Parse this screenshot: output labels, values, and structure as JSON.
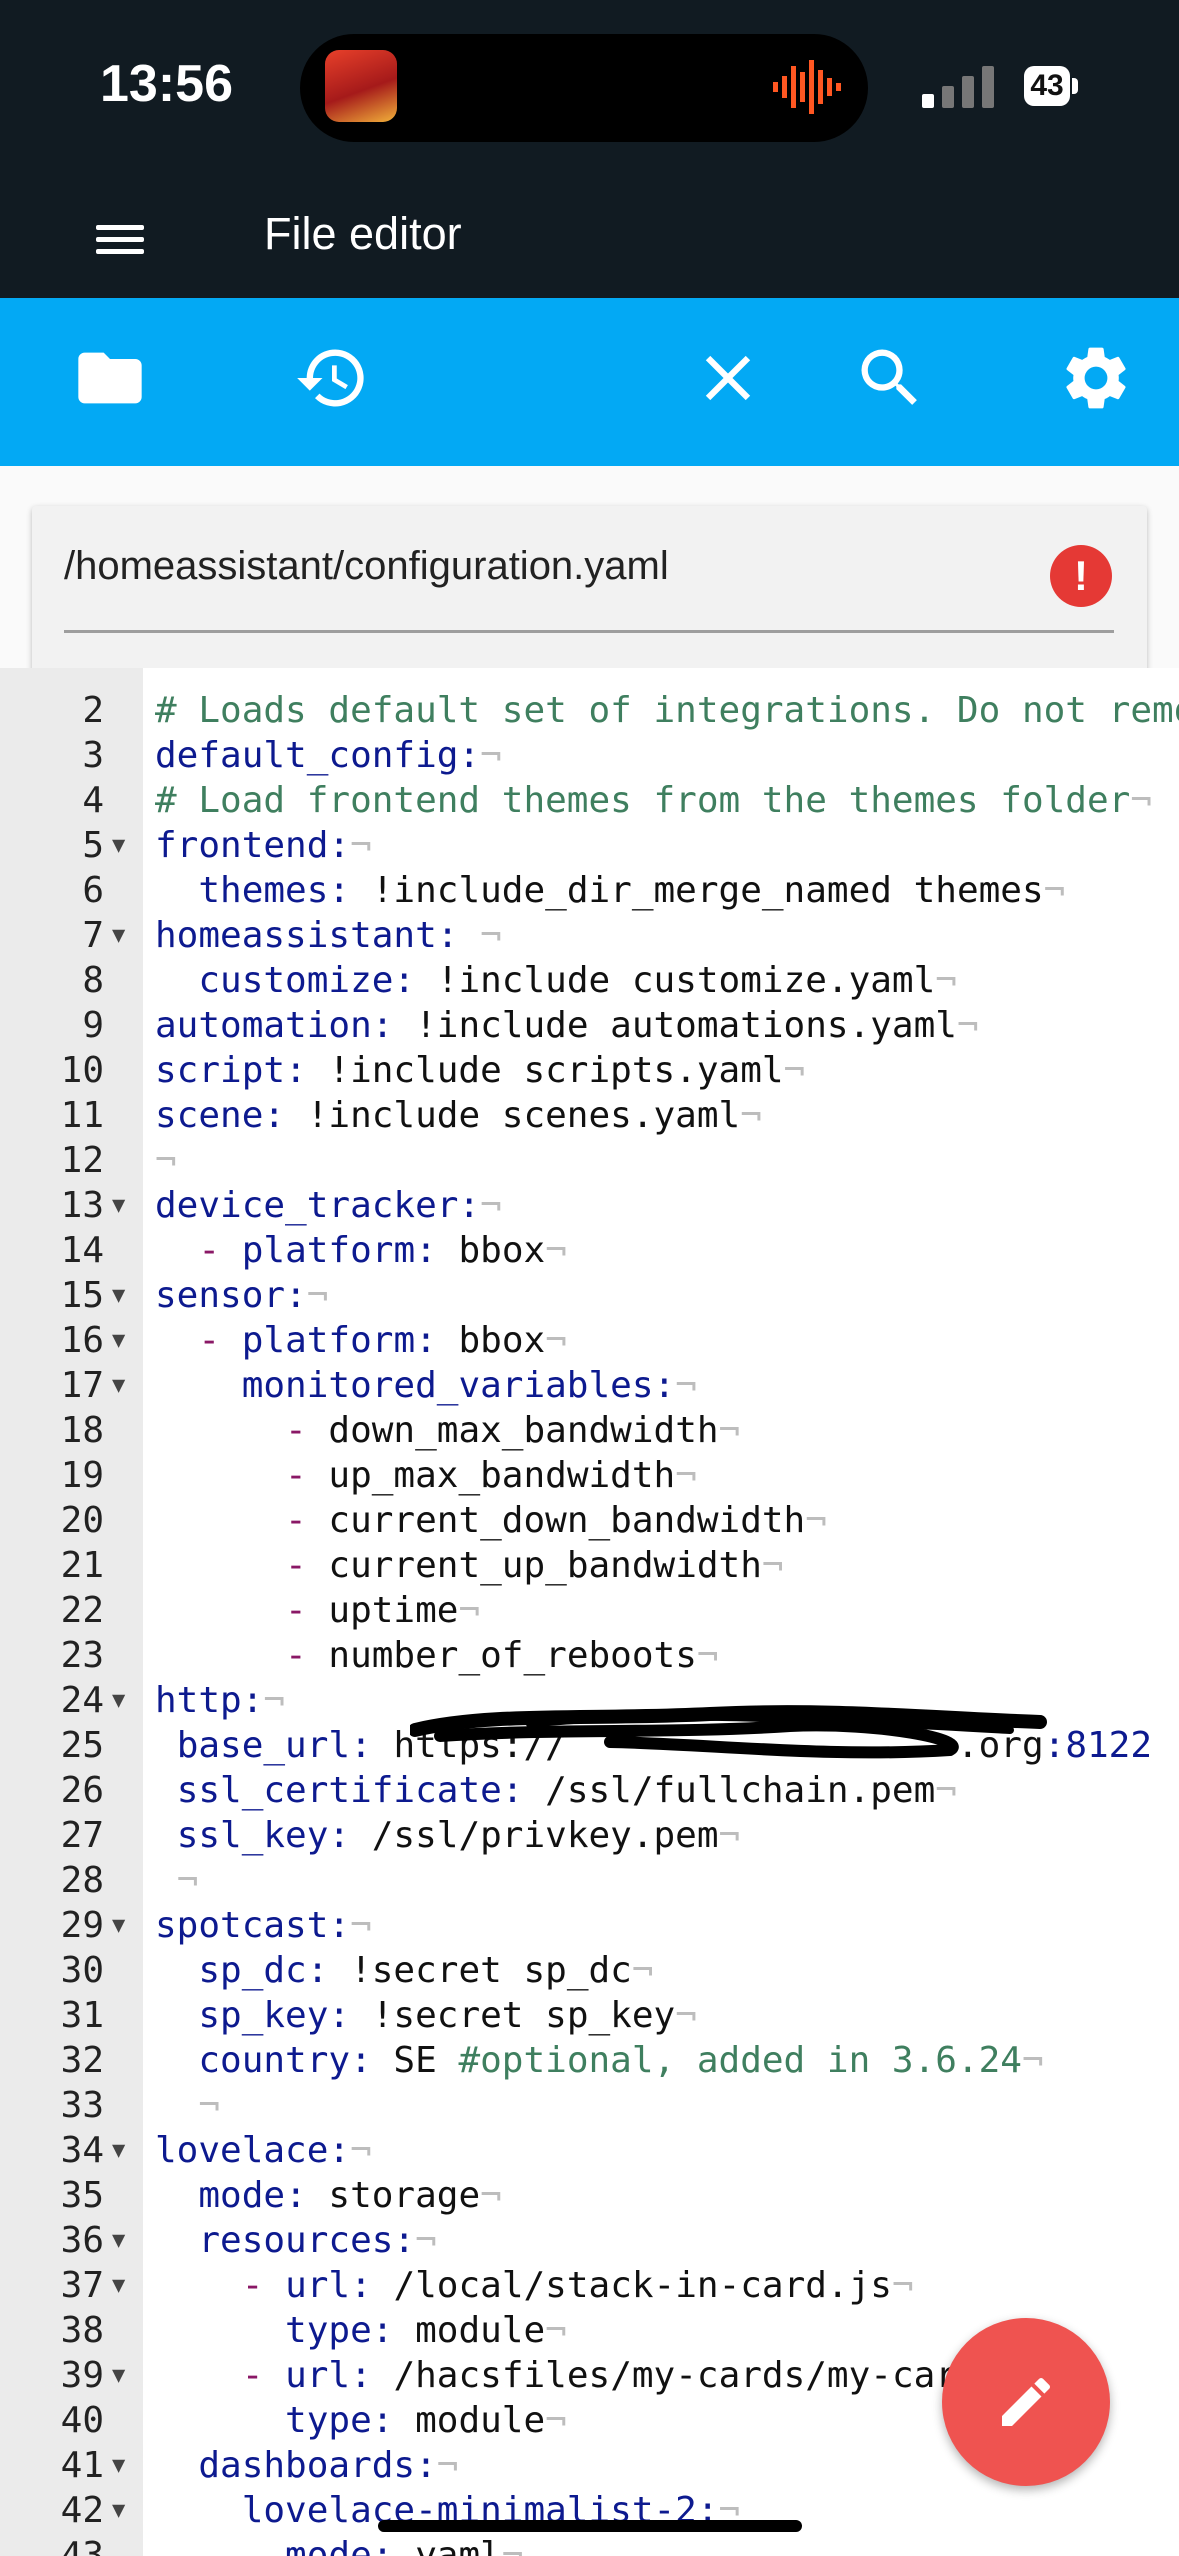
{
  "status_bar": {
    "time": "13:56",
    "battery": "43"
  },
  "app": {
    "title": "File editor"
  },
  "toolbar": {
    "icons": [
      "folder-icon",
      "history-icon",
      "close-icon",
      "search-icon",
      "settings-icon"
    ]
  },
  "file": {
    "path": "/homeassistant/configuration.yaml"
  },
  "colors": {
    "toolbar": "#03a9f4",
    "appbar": "#111b22",
    "fab": "#ef5350",
    "error": "#e53935",
    "key": "#0d1a8f",
    "comment": "#3f7f5f"
  },
  "editor": {
    "lines": [
      {
        "n": "2",
        "fold": false,
        "html": "<span class='c'># Loads default set of integrations. Do not remo</span>"
      },
      {
        "n": "3",
        "fold": false,
        "html": "<span class='k'>default_config:</span><span class='ws'>¬</span>"
      },
      {
        "n": "4",
        "fold": false,
        "html": "<span class='c'># Load frontend themes from the themes folder</span><span class='ws'>¬</span>"
      },
      {
        "n": "5",
        "fold": true,
        "html": "<span class='k'>frontend:</span><span class='ws'>¬</span>"
      },
      {
        "n": "6",
        "fold": false,
        "html": "  <span class='k'>themes:</span> !include_dir_merge_named themes<span class='ws'>¬</span>"
      },
      {
        "n": "7",
        "fold": true,
        "html": "<span class='k'>homeassistant:</span> <span class='ws'>¬</span>"
      },
      {
        "n": "8",
        "fold": false,
        "html": "  <span class='k'>customize:</span> !include customize.yaml<span class='ws'>¬</span>"
      },
      {
        "n": "9",
        "fold": false,
        "html": "<span class='k'>automation:</span> !include automations.yaml<span class='ws'>¬</span>"
      },
      {
        "n": "10",
        "fold": false,
        "html": "<span class='k'>script:</span> !include scripts.yaml<span class='ws'>¬</span>"
      },
      {
        "n": "11",
        "fold": false,
        "html": "<span class='k'>scene:</span> !include scenes.yaml<span class='ws'>¬</span>"
      },
      {
        "n": "12",
        "fold": false,
        "html": "<span class='ws'>¬</span>"
      },
      {
        "n": "13",
        "fold": true,
        "html": "<span class='k'>device_tracker:</span><span class='ws'>¬</span>"
      },
      {
        "n": "14",
        "fold": false,
        "html": "  <span class='d'>-</span> <span class='k'>platform:</span> bbox<span class='ws'>¬</span>"
      },
      {
        "n": "15",
        "fold": true,
        "html": "<span class='k'>sensor:</span><span class='ws'>¬</span>"
      },
      {
        "n": "16",
        "fold": true,
        "html": "  <span class='d'>-</span> <span class='k'>platform:</span> bbox<span class='ws'>¬</span>"
      },
      {
        "n": "17",
        "fold": true,
        "html": "    <span class='k'>monitored_variables:</span><span class='ws'>¬</span>"
      },
      {
        "n": "18",
        "fold": false,
        "html": "      <span class='d'>-</span> down_max_bandwidth<span class='ws'>¬</span>"
      },
      {
        "n": "19",
        "fold": false,
        "html": "      <span class='d'>-</span> up_max_bandwidth<span class='ws'>¬</span>"
      },
      {
        "n": "20",
        "fold": false,
        "html": "      <span class='d'>-</span> current_down_bandwidth<span class='ws'>¬</span>"
      },
      {
        "n": "21",
        "fold": false,
        "html": "      <span class='d'>-</span> current_up_bandwidth<span class='ws'>¬</span>"
      },
      {
        "n": "22",
        "fold": false,
        "html": "      <span class='d'>-</span> uptime<span class='ws'>¬</span>"
      },
      {
        "n": "23",
        "fold": false,
        "html": "      <span class='d'>-</span> number_of_reboots<span class='ws'>¬</span>"
      },
      {
        "n": "24",
        "fold": true,
        "html": "<span class='k'>http:</span><span class='ws'>¬</span>"
      },
      {
        "n": "25",
        "fold": false,
        "html": " <span class='k'>base_url:</span> https://                  .org<span class='num'>:8122</span>"
      },
      {
        "n": "26",
        "fold": false,
        "html": " <span class='k'>ssl_certificate:</span> /ssl/fullchain.pem<span class='ws'>¬</span>"
      },
      {
        "n": "27",
        "fold": false,
        "html": " <span class='k'>ssl_key:</span> /ssl/privkey.pem<span class='ws'>¬</span>"
      },
      {
        "n": "28",
        "fold": false,
        "html": " <span class='ws'>¬</span>"
      },
      {
        "n": "29",
        "fold": true,
        "html": "<span class='k'>spotcast:</span><span class='ws'>¬</span>"
      },
      {
        "n": "30",
        "fold": false,
        "html": "  <span class='k'>sp_dc:</span> !secret sp_dc<span class='ws'>¬</span>"
      },
      {
        "n": "31",
        "fold": false,
        "html": "  <span class='k'>sp_key:</span> !secret sp_key<span class='ws'>¬</span>"
      },
      {
        "n": "32",
        "fold": false,
        "html": "  <span class='k'>country:</span> SE <span class='c'>#optional, added in 3.6.24</span><span class='ws'>¬</span>"
      },
      {
        "n": "33",
        "fold": false,
        "html": "  <span class='ws'>¬</span>"
      },
      {
        "n": "34",
        "fold": true,
        "html": "<span class='k'>lovelace:</span><span class='ws'>¬</span>"
      },
      {
        "n": "35",
        "fold": false,
        "html": "  <span class='k'>mode:</span> storage<span class='ws'>¬</span>"
      },
      {
        "n": "36",
        "fold": true,
        "html": "  <span class='k'>resources:</span><span class='ws'>¬</span>"
      },
      {
        "n": "37",
        "fold": true,
        "html": "    <span class='d'>-</span> <span class='k'>url:</span> /local/stack-in-card.js<span class='ws'>¬</span>"
      },
      {
        "n": "38",
        "fold": false,
        "html": "      <span class='k'>type:</span> module<span class='ws'>¬</span>"
      },
      {
        "n": "39",
        "fold": true,
        "html": "    <span class='d'>-</span> <span class='k'>url:</span> /hacsfiles/my-cards/my-car"
      },
      {
        "n": "40",
        "fold": false,
        "html": "      <span class='k'>type:</span> module<span class='ws'>¬</span>"
      },
      {
        "n": "41",
        "fold": true,
        "html": "  <span class='k'>dashboards:</span><span class='ws'>¬</span>"
      },
      {
        "n": "42",
        "fold": true,
        "html": "    <span class='k'>lovelace-minimalist-2:</span><span class='ws'>¬</span>"
      },
      {
        "n": "43",
        "fold": false,
        "html": "      <span class='k'>mode:</span> yaml<span class='ws'>¬</span>"
      }
    ]
  }
}
